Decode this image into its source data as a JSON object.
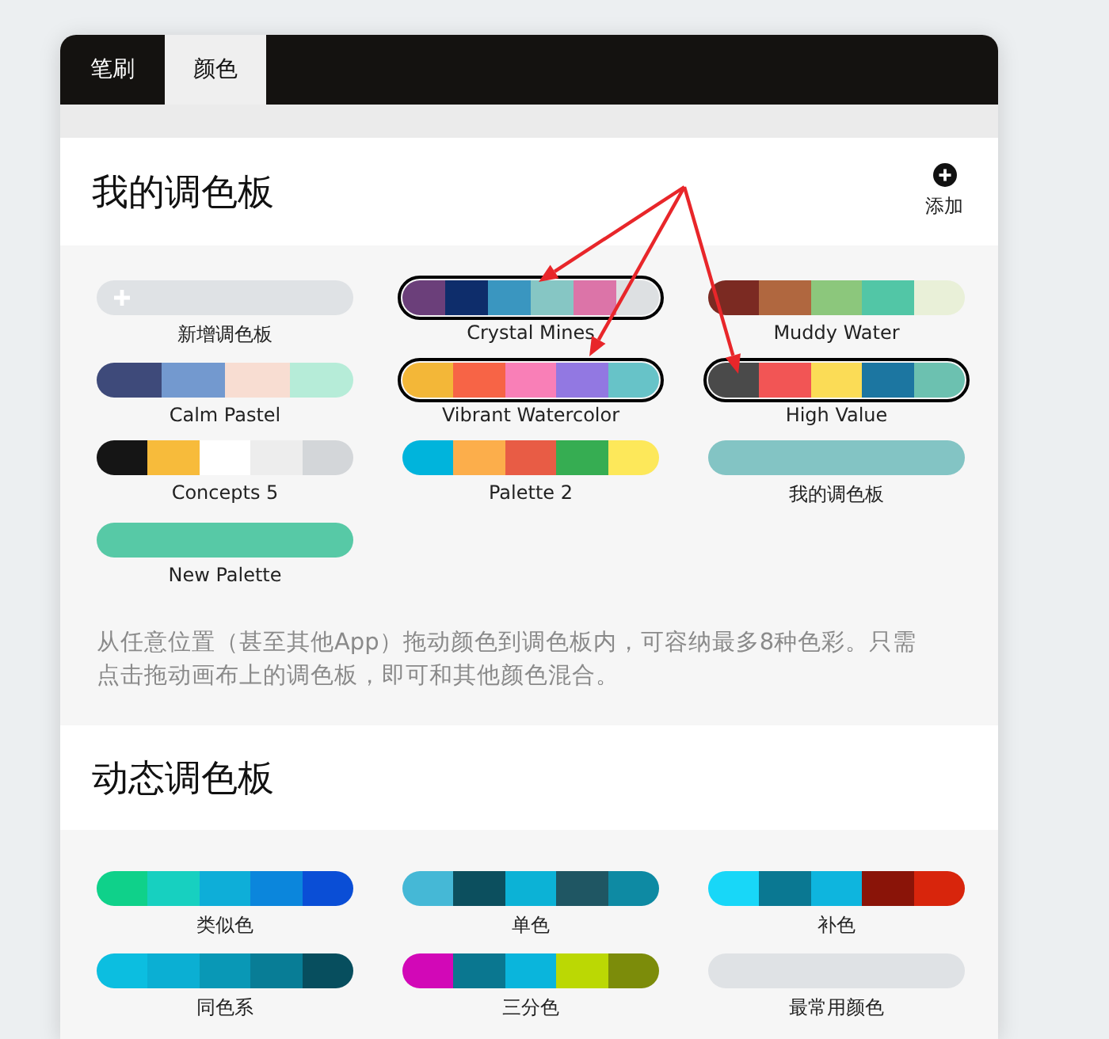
{
  "tabs": [
    {
      "label": "笔刷",
      "selected": false
    },
    {
      "label": "颜色",
      "selected": true
    }
  ],
  "my_palettes": {
    "title": "我的调色板",
    "add_button": {
      "label": "添加"
    },
    "palettes": [
      {
        "kind": "new",
        "name": "新增调色板",
        "selected": false,
        "swatches": [
          {
            "color": "#dfe2e5"
          }
        ]
      },
      {
        "kind": "swatches",
        "name": "Crystal Mines",
        "selected": true,
        "swatches": [
          {
            "color": "#6b3f7a"
          },
          {
            "color": "#0e2d6b"
          },
          {
            "color": "#3a96c0"
          },
          {
            "color": "#86c6c4"
          },
          {
            "color": "#dc74a8"
          },
          {
            "color": "#dde0e2"
          }
        ]
      },
      {
        "kind": "swatches",
        "name": "Muddy Water",
        "selected": false,
        "swatches": [
          {
            "color": "#7b2a22"
          },
          {
            "color": "#b0673f"
          },
          {
            "color": "#8cc77c"
          },
          {
            "color": "#52c6a6"
          },
          {
            "color": "#e9f0d8"
          }
        ]
      },
      {
        "kind": "swatches",
        "name": "Calm Pastel",
        "selected": false,
        "swatches": [
          {
            "color": "#3e4a7a"
          },
          {
            "color": "#7399cf"
          },
          {
            "color": "#f8ddd2"
          },
          {
            "color": "#b6ecd8"
          }
        ]
      },
      {
        "kind": "swatches",
        "name": "Vibrant Watercolor",
        "selected": true,
        "swatches": [
          {
            "color": "#f3b738"
          },
          {
            "color": "#f76446"
          },
          {
            "color": "#f97fb7"
          },
          {
            "color": "#9278e2"
          },
          {
            "color": "#67c3c8"
          }
        ]
      },
      {
        "kind": "swatches",
        "name": "High Value",
        "selected": true,
        "swatches": [
          {
            "color": "#4a4a4a"
          },
          {
            "color": "#f25555"
          },
          {
            "color": "#fbdc56"
          },
          {
            "color": "#1c76a1"
          },
          {
            "color": "#6cc1b0"
          }
        ]
      },
      {
        "kind": "swatches",
        "name": "Concepts 5",
        "selected": false,
        "swatches": [
          {
            "color": "#151515"
          },
          {
            "color": "#f7bb3b"
          },
          {
            "color": "#ffffff"
          },
          {
            "color": "#ededed"
          },
          {
            "color": "#d3d6d9"
          }
        ]
      },
      {
        "kind": "swatches",
        "name": "Palette 2",
        "selected": false,
        "swatches": [
          {
            "color": "#00b4dc"
          },
          {
            "color": "#fcae4b"
          },
          {
            "color": "#e85c45"
          },
          {
            "color": "#36ad52"
          },
          {
            "color": "#fde85a"
          }
        ]
      },
      {
        "kind": "swatches",
        "name": "我的调色板",
        "selected": false,
        "swatches": [
          {
            "color": "#83c4c4"
          }
        ]
      },
      {
        "kind": "swatches",
        "name": "New Palette",
        "selected": false,
        "swatches": [
          {
            "color": "#57c9a6"
          }
        ]
      }
    ],
    "description": "从任意位置（甚至其他App）拖动颜色到调色板内，可容纳最多8种色彩。只需点击拖动画布上的调色板，即可和其他颜色混合。"
  },
  "dynamic_palettes": {
    "title": "动态调色板",
    "palettes": [
      {
        "name": "类似色",
        "swatches": [
          {
            "color": "#0fd18a"
          },
          {
            "color": "#17d0c0"
          },
          {
            "color": "#0eaed8"
          },
          {
            "color": "#0b86dc"
          },
          {
            "color": "#0a4ed6"
          }
        ]
      },
      {
        "name": "单色",
        "swatches": [
          {
            "color": "#45b8d6"
          },
          {
            "color": "#0c4f5e"
          },
          {
            "color": "#0cb2d6"
          },
          {
            "color": "#1f5663"
          },
          {
            "color": "#0e8aa3"
          }
        ]
      },
      {
        "name": "补色",
        "swatches": [
          {
            "color": "#18d7f8"
          },
          {
            "color": "#0a7892"
          },
          {
            "color": "#0eb5de"
          },
          {
            "color": "#8a1408"
          },
          {
            "color": "#d8250c"
          }
        ]
      },
      {
        "name": "同色系",
        "swatches": [
          {
            "color": "#0cbee0"
          },
          {
            "color": "#0bafd3"
          },
          {
            "color": "#0998b6"
          },
          {
            "color": "#087d96"
          },
          {
            "color": "#074e5e"
          }
        ]
      },
      {
        "name": "三分色",
        "swatches": [
          {
            "color": "#d208b7"
          },
          {
            "color": "#0a7790"
          },
          {
            "color": "#0ab5dc"
          },
          {
            "color": "#bbd804"
          },
          {
            "color": "#7c8c0a"
          }
        ]
      },
      {
        "name": "最常用颜色",
        "swatches": [
          {
            "color": "#dfe2e5"
          }
        ]
      }
    ]
  }
}
